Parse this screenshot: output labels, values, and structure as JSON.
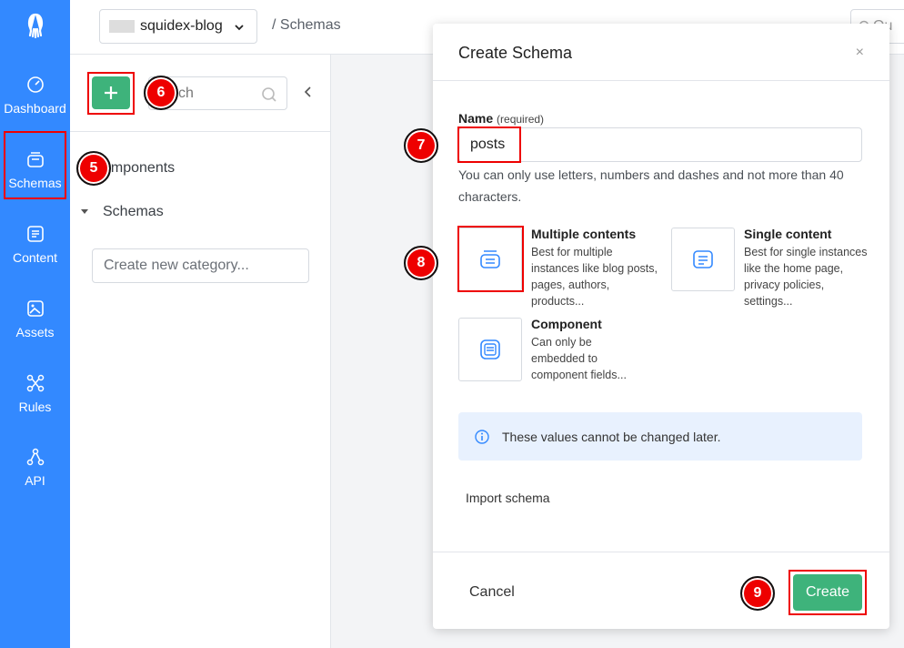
{
  "nav": {
    "items": [
      {
        "label": "Dashboard",
        "icon": "dashboard-icon"
      },
      {
        "label": "Schemas",
        "icon": "schemas-icon"
      },
      {
        "label": "Content",
        "icon": "content-icon"
      },
      {
        "label": "Assets",
        "icon": "assets-icon"
      },
      {
        "label": "Rules",
        "icon": "rules-icon"
      },
      {
        "label": "API",
        "icon": "api-icon"
      }
    ]
  },
  "topbar": {
    "app_name": "squidex-blog",
    "breadcrumb": "/  Schemas",
    "search_placeholder": "Qu"
  },
  "panel": {
    "search_placeholder": "ch",
    "categories": [
      "omponents",
      "Schemas"
    ],
    "new_category_placeholder": "Create new category..."
  },
  "modal": {
    "title": "Create Schema",
    "close": "×",
    "name_label": "Name",
    "name_required": "(required)",
    "name_value": "posts",
    "hint": "You can only use letters, numbers and dashes and not more than 40 characters.",
    "types": [
      {
        "title": "Multiple contents",
        "desc": "Best for multiple instances like blog posts, pages, authors, products..."
      },
      {
        "title": "Single content",
        "desc": "Best for single instances like the home page, privacy policies, settings..."
      },
      {
        "title": "Component",
        "desc": "Can only be embedded to component fields..."
      }
    ],
    "info": "These values cannot be changed later.",
    "import": "Import schema",
    "cancel": "Cancel",
    "create": "Create"
  },
  "markers": [
    "5",
    "6",
    "7",
    "8",
    "9"
  ],
  "colors": {
    "nav": "#3389ff",
    "accent_green": "#3eb37b",
    "highlight": "#ee0000"
  }
}
